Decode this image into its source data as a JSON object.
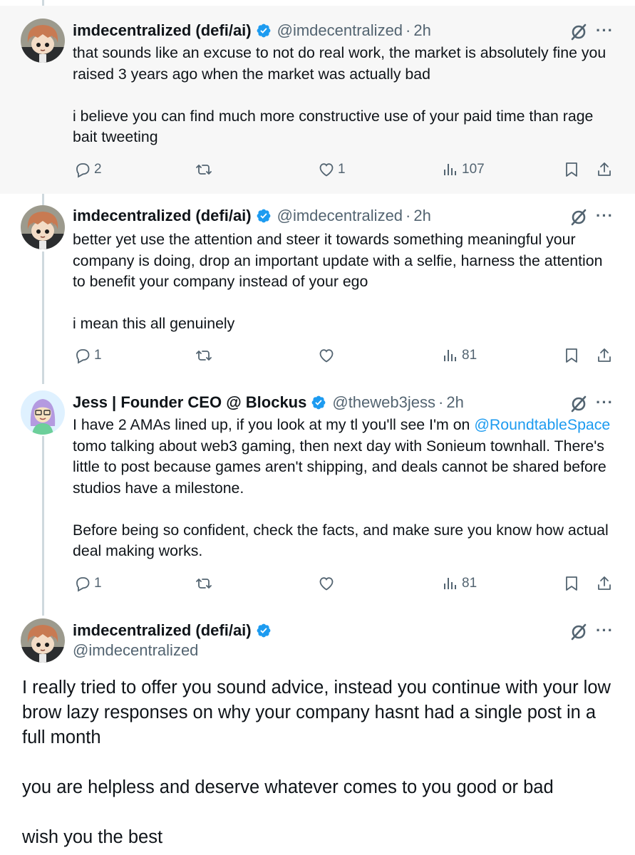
{
  "posts": [
    {
      "name": "imdecentralized (defi/ai)",
      "handle": "@imdecentralized",
      "time": "2h",
      "text": [
        "that sounds like an excuse to not do real work, the market is absolutely fine you raised 3 years ago when the market was actually bad",
        "i believe you can find much more constructive use of your paid time than rage bait tweeting"
      ],
      "replies": "2",
      "reposts": "",
      "likes": "1",
      "views": "107"
    },
    {
      "name": "imdecentralized (defi/ai)",
      "handle": "@imdecentralized",
      "time": "2h",
      "text": [
        "better yet use the attention and steer it towards something meaningful your company is doing, drop an important update with a selfie, harness the attention to benefit your company instead of your ego",
        "i mean this all genuinely"
      ],
      "replies": "1",
      "reposts": "",
      "likes": "",
      "views": "81"
    },
    {
      "name": "Jess | Founder CEO @ Blockus",
      "handle": "@theweb3jess",
      "time": "2h",
      "text_before_mention": "I have 2 AMAs lined up, if you look at my tl you'll see I'm on ",
      "mention": "@RoundtableSpace",
      "text_after_mention": " tomo talking about web3 gaming, then next day with Sonieum townhall. There's little to post because games aren't shipping, and deals cannot be shared before studios have a milestone.",
      "text_2": "Before being so confident, check the facts, and make sure you know how actual deal making works.",
      "replies": "1",
      "reposts": "",
      "likes": "",
      "views": "81"
    },
    {
      "name": "imdecentralized (defi/ai)",
      "handle": "@imdecentralized",
      "text": [
        "I really tried to offer you sound advice, instead you continue with your low brow lazy responses on why your company hasnt had a single post in a full month",
        "you are helpless and deserve whatever comes to you good or bad",
        "wish you the best"
      ]
    }
  ],
  "ui": {
    "dot": "·",
    "more": "···"
  },
  "colors": {
    "verified": "#1d9bf0",
    "mention": "#1d9bf0",
    "secondary_text": "#536471",
    "thread_line": "#cfd9de",
    "highlight_bg": "#f7f7f7"
  },
  "icons": [
    "verified-badge-icon",
    "grok-icon",
    "more-icon",
    "reply-icon",
    "repost-icon",
    "like-icon",
    "views-icon",
    "bookmark-icon",
    "share-icon"
  ]
}
